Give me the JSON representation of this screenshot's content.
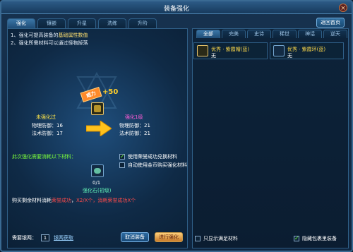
{
  "window": {
    "title": "装备强化",
    "close_label": "×"
  },
  "tabs": [
    "强化",
    "镶嵌",
    "升星",
    "洗练",
    "升阶"
  ],
  "home_button": "返回首页",
  "tips": {
    "line1_prefix": "1、强化可提高装备的",
    "line1_highlight": "基础属性数值",
    "line2": "2、强化所需材料可以通过怪物掉落"
  },
  "power_badge": "威力",
  "power_plus": "+50",
  "before": {
    "title": "未强化过",
    "stats": [
      {
        "label": "物理防御：",
        "value": "16"
      },
      {
        "label": "法术防御：",
        "value": "17"
      }
    ]
  },
  "after": {
    "title": "强化1级",
    "stats": [
      {
        "label": "物理防御：",
        "value": "21"
      },
      {
        "label": "法术防御：",
        "value": "21"
      }
    ]
  },
  "need_text": "此次强化需要消耗以下材料：",
  "checks": [
    {
      "label": "使用荣誉成功兑换材料",
      "checked": true
    },
    {
      "label": "自动使用金币购买强化材料",
      "checked": false
    }
  ],
  "stone": {
    "count": "0/1",
    "name": "强化石(初级)"
  },
  "buy_text": {
    "prefix": "购买剩余材料消耗",
    "red1": "荣誉成功",
    "sep": "，",
    "red2": "X2/X个，消耗荣誉成功X个"
  },
  "bottom": {
    "label": "需要银两：",
    "qty": "1",
    "link": "银两获取"
  },
  "buttons": {
    "cancel": "取消装备",
    "confirm": "进行强化"
  },
  "right_tabs": [
    "全部",
    "完美",
    "史诗",
    "稀世",
    "神话",
    "逆天"
  ],
  "equip": [
    {
      "name": "优秀 · 紫霞帽(蓝)",
      "sub": "无"
    },
    {
      "name": "优秀 · 紫霞环(蓝)",
      "sub": "无"
    }
  ],
  "right_bottom": [
    {
      "label": "只显示满足材料",
      "checked": false
    },
    {
      "label": "隐藏包裹里装备",
      "checked": true
    }
  ]
}
